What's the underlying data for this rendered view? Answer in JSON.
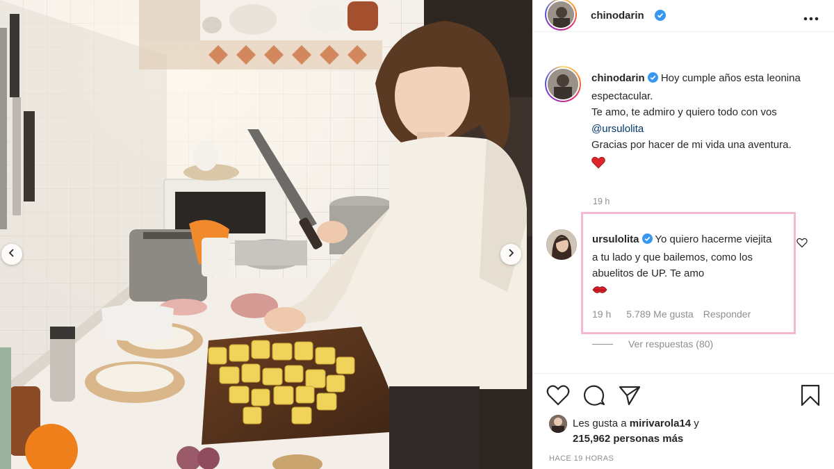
{
  "post": {
    "header": {
      "username": "chinodarin"
    },
    "caption": {
      "username": "chinodarin",
      "text_before_mention": "Hoy cumple años esta leonina espectacular.",
      "line_two": "Te amo, te admiro y quiero todo con vos",
      "mention": "@ursulolita",
      "line_three": "Gracias por hacer de mi vida una aventura.",
      "time": "19 h"
    },
    "comment": {
      "username": "ursulolita",
      "text": "Yo quiero hacerme viejita a tu lado y que bailemos, como los abuelitos de UP. Te amo",
      "time": "19 h",
      "likes": "5.789 Me gusta",
      "reply_label": "Responder",
      "view_replies": "Ver respuestas (80)"
    },
    "likes": {
      "prefix": "Les gusta a",
      "first_user": "mirivarola14",
      "connector": "y",
      "others": "215,962 personas más"
    },
    "posted_ago": "HACE 19 HORAS"
  },
  "icons": {
    "heart": "heart-icon",
    "comment": "comment-icon",
    "share": "share-icon",
    "bookmark": "bookmark-icon",
    "more": "more-options-icon",
    "verified": "verified-badge-icon",
    "prev": "chevron-left-icon",
    "next": "chevron-right-icon"
  },
  "colors": {
    "verified_blue": "#3897f0",
    "highlight_border": "#f4b8d2",
    "mention": "#00376b",
    "muted": "#8e8e8e"
  }
}
